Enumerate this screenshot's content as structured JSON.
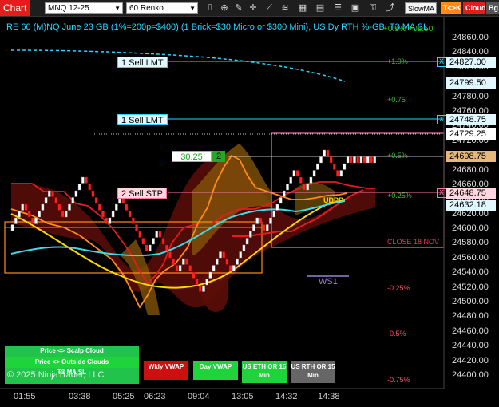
{
  "toolbar": {
    "title": "Chart",
    "instrument": "MNQ 12-25",
    "bars": "60 Renko",
    "slow_ma": "SlowMA",
    "tk_label": "T<>K",
    "cloud_label": "Cloud",
    "bg_label": "Bg"
  },
  "chart_title": "RE 60 (M)NQ June 23 GB (1%=200p=$400) (1 Brick=$30 Micro or $300 Mini), US Dy RTH %-GB, T3 MA SL",
  "top_overlap": "+0.5% +05.50",
  "price_axis": {
    "ticks": [
      "24860.00",
      "24840.00",
      "24820.00",
      "24800.00",
      "24780.00",
      "24760.00",
      "24740.00",
      "24720.00",
      "24700.00",
      "24680.00",
      "24660.00",
      "24640.00",
      "24620.00",
      "24600.00",
      "24580.00",
      "24560.00",
      "24540.00",
      "24520.00",
      "24500.00",
      "24480.00",
      "24460.00",
      "24440.00",
      "24420.00",
      "24400.00"
    ],
    "tick_values": [
      24860,
      24840,
      24820,
      24800,
      24780,
      24760,
      24740,
      24720,
      24700,
      24680,
      24660,
      24640,
      24620,
      24600,
      24580,
      24560,
      24540,
      24520,
      24500,
      24480,
      24460,
      24440,
      24420,
      24400
    ],
    "labels": [
      {
        "text": "24827.00",
        "value": 24827.0,
        "bg": "#e0f7ff"
      },
      {
        "text": "24799.50",
        "value": 24799.5,
        "bg": "#e0f7ff"
      },
      {
        "text": "24748.75",
        "value": 24748.75,
        "bg": "#e0f7ff"
      },
      {
        "text": "24729.25",
        "value": 24729.25,
        "bg": "#ffffff"
      },
      {
        "text": "24698.75",
        "value": 24698.75,
        "bg": "#e6b87a"
      },
      {
        "text": "24648.75",
        "value": 24648.75,
        "bg": "#ffd6e0"
      },
      {
        "text": "24632.18",
        "value": 24632.18,
        "bg": "#e0f7ff"
      }
    ]
  },
  "percent_levels": [
    {
      "text": "+1.0%",
      "value": 24827.0,
      "color": "#22cc22"
    },
    {
      "text": "+0.75",
      "value": 24775.0,
      "color": "#22cc22"
    },
    {
      "text": "+0.5%",
      "value": 24698.75,
      "color": "#22cc22"
    },
    {
      "text": "+0.25%",
      "value": 24645.0,
      "color": "#22cc22"
    },
    {
      "text": "-0.25%",
      "value": 24518.0,
      "color": "#ff4d6d"
    },
    {
      "text": "-0.5%",
      "value": 24457.0,
      "color": "#ff4d6d"
    },
    {
      "text": "-0.75%",
      "value": 24393.0,
      "color": "#ff4d6d"
    }
  ],
  "orders": [
    {
      "label": "1 Sell LMT",
      "value": 24827.0,
      "style": "lmt",
      "close": "X"
    },
    {
      "label": "1 Sell LMT",
      "value": 24748.75,
      "style": "lmt",
      "close": "X"
    },
    {
      "label": "2 Sell STP",
      "value": 24648.75,
      "style": "stp",
      "close": "X"
    }
  ],
  "position": {
    "price": "30.25",
    "qty": "2"
  },
  "annotations": {
    "close_label": "CLOSE 18 NOV",
    "ws_label": "WS1",
    "udpp_label": "UDPP"
  },
  "time_axis": [
    "01:55",
    "03:38",
    "05:25",
    "06:23",
    "09:04",
    "13:05",
    "14:32",
    "14:38"
  ],
  "legend": {
    "scalp_cloud": "Price <> Scalp Cloud",
    "outside_clouds": "Price <> Outside Clouds",
    "t3_ma_sl": "T3 MA SL",
    "wkly_vwap": "Wkly VWAP",
    "day_vwap": "Day VWAP",
    "us_eth": "US ETH OR 15 Min",
    "us_rth": "US RTH OR 15 Min",
    "copyright": "© 2025 NinjaTrader, LLC"
  },
  "colors": {
    "accent_cyan": "#2bd5ff",
    "up_brick": "#ffffff",
    "down_brick": "#ff2020",
    "vwap_gold": "#ffd700",
    "orange_box": "#ff8c1a",
    "pink_box": "#ff6fa8"
  }
}
